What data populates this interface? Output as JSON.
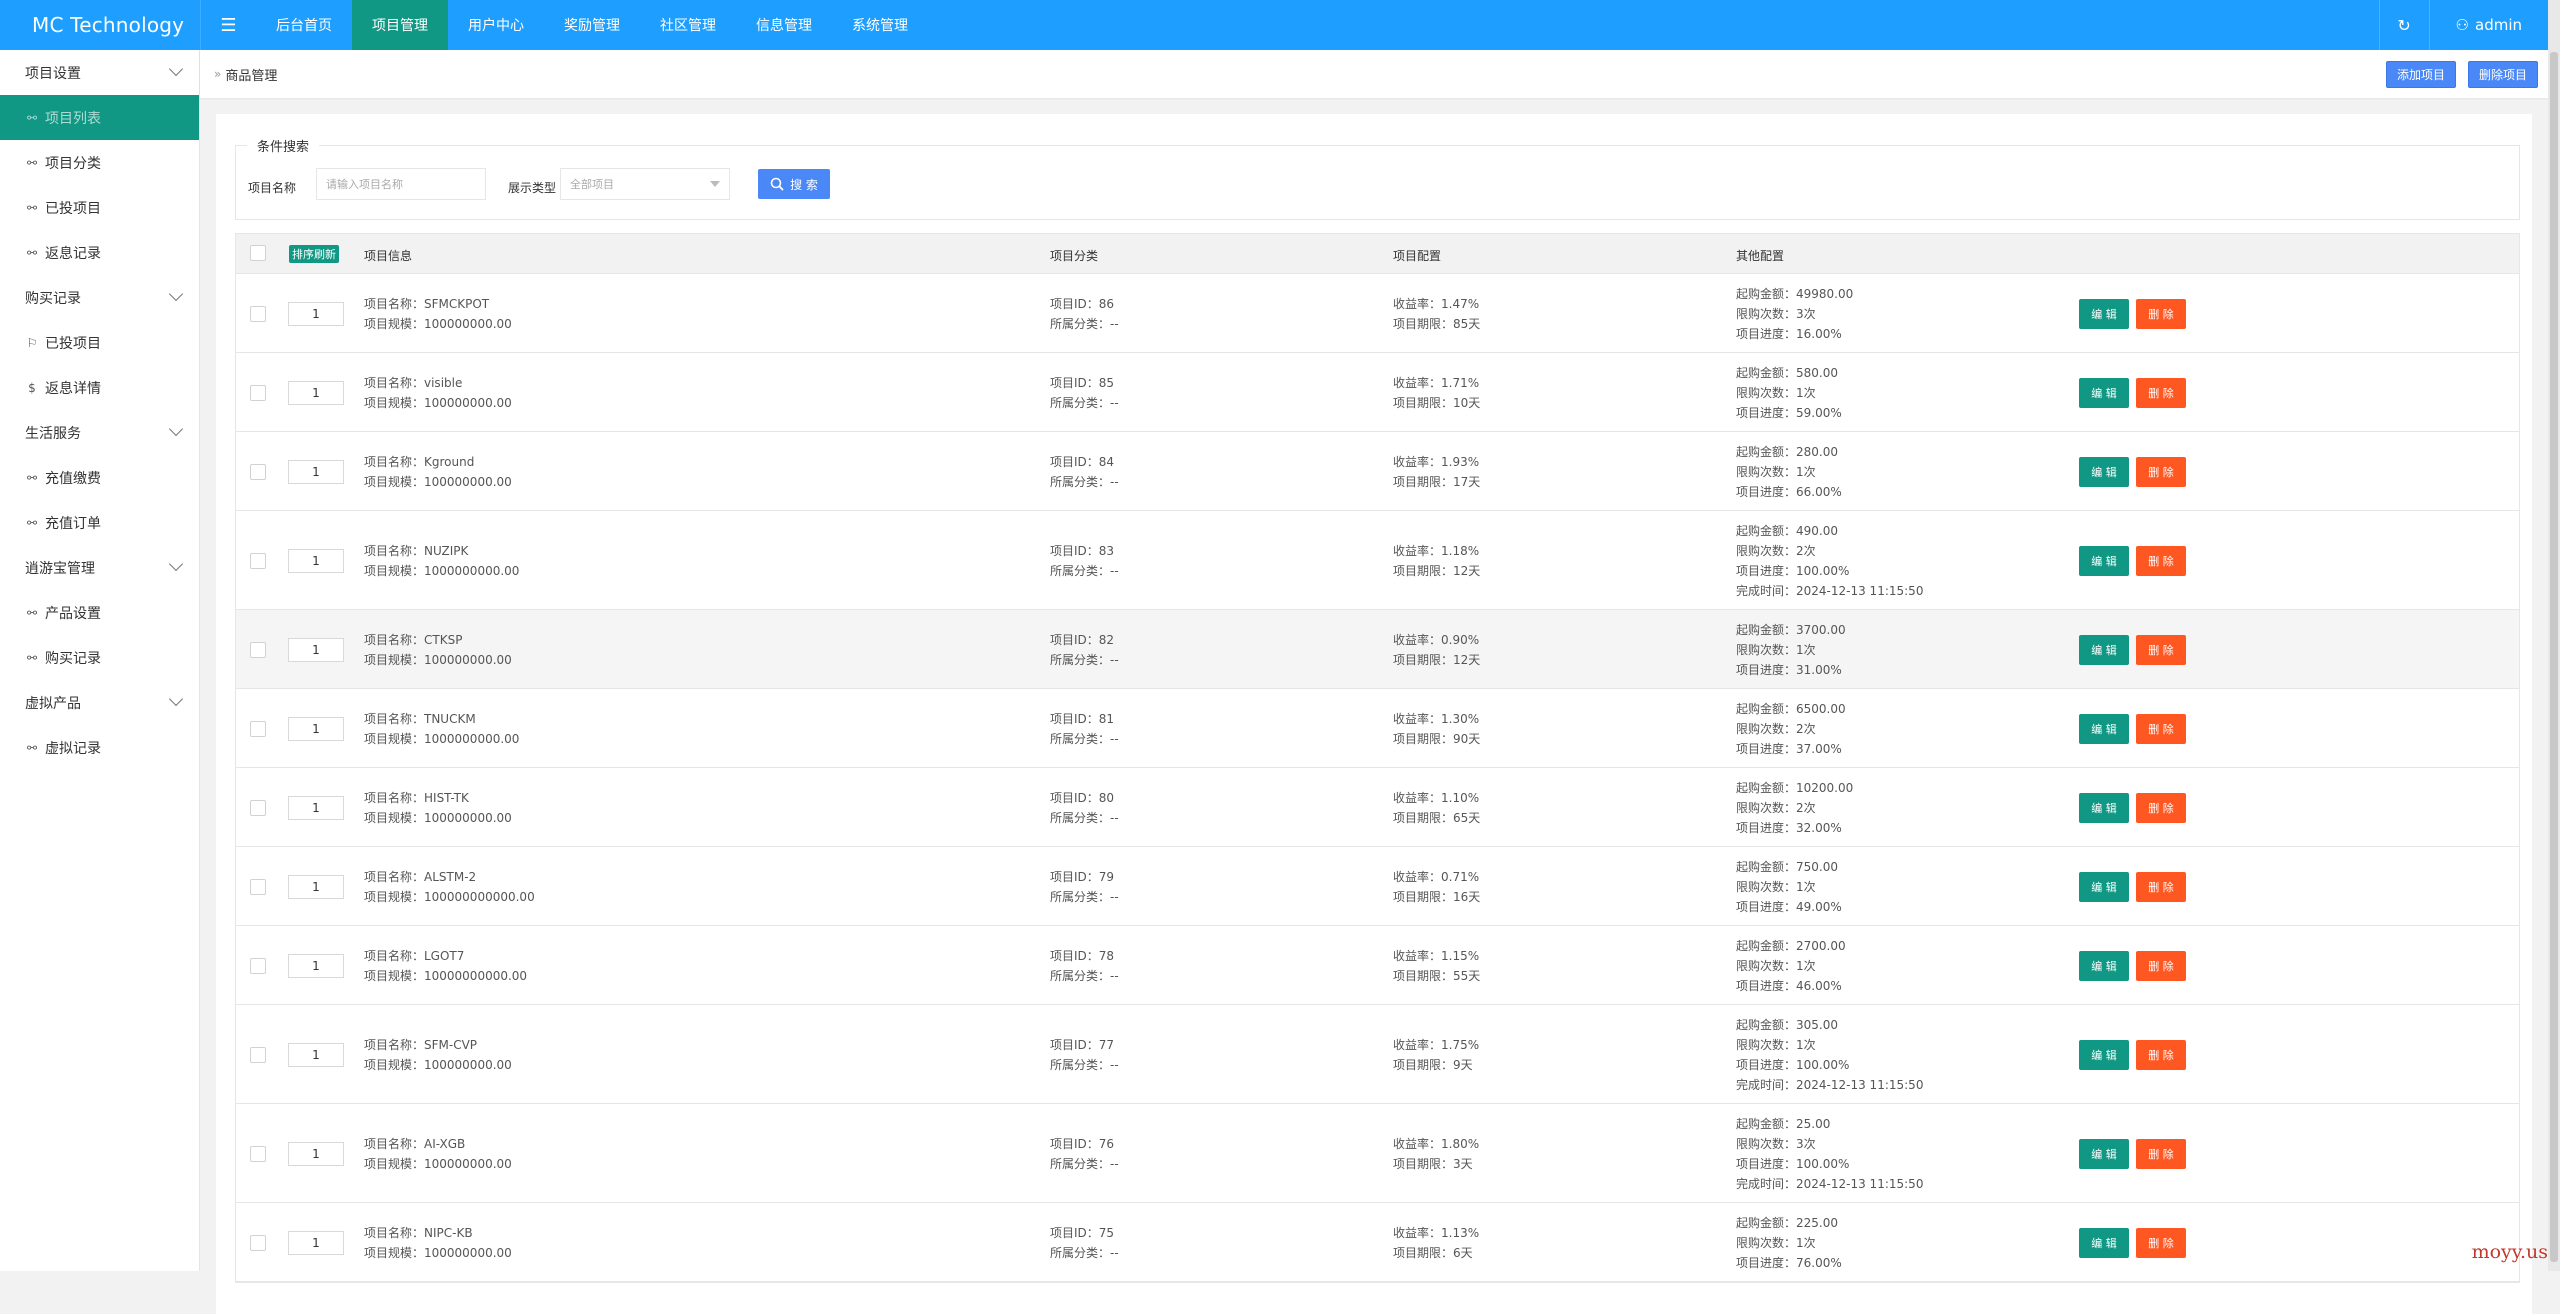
{
  "topbar": {
    "brand": "MC Technology",
    "nav": [
      "后台首页",
      "项目管理",
      "用户中心",
      "奖励管理",
      "社区管理",
      "信息管理",
      "系统管理"
    ],
    "active_nav": 1,
    "user": "admin",
    "accent": "#1e9fff",
    "active_color": "#119885"
  },
  "sidebar": [
    {
      "label": "项目设置",
      "type": "group"
    },
    {
      "label": "项目列表",
      "type": "active",
      "icon": "link-icon"
    },
    {
      "label": "项目分类",
      "type": "sub",
      "icon": "link-icon"
    },
    {
      "label": "已投项目",
      "type": "sub",
      "icon": "link-icon"
    },
    {
      "label": "返息记录",
      "type": "sub",
      "icon": "link-icon"
    },
    {
      "label": "购买记录",
      "type": "group"
    },
    {
      "label": "已投项目",
      "type": "sub",
      "icon": "flag-icon"
    },
    {
      "label": "返息详情",
      "type": "sub",
      "icon": "coin-icon"
    },
    {
      "label": "生活服务",
      "type": "group"
    },
    {
      "label": "充值缴费",
      "type": "sub",
      "icon": "link-icon"
    },
    {
      "label": "充值订单",
      "type": "sub",
      "icon": "link-icon"
    },
    {
      "label": "逍游宝管理",
      "type": "group"
    },
    {
      "label": "产品设置",
      "type": "sub",
      "icon": "link-icon"
    },
    {
      "label": "购买记录",
      "type": "sub",
      "icon": "link-icon"
    },
    {
      "label": "虚拟产品",
      "type": "group"
    },
    {
      "label": "虚拟记录",
      "type": "sub",
      "icon": "link-icon"
    }
  ],
  "breadcrumb": "商品管理",
  "actions": {
    "add": "添加项目",
    "delete": "删除项目"
  },
  "search": {
    "legend": "条件搜索",
    "name_label": "项目名称",
    "name_placeholder": "请输入项目名称",
    "type_label": "展示类型",
    "type_value": "全部项目",
    "button": "搜 索"
  },
  "table": {
    "sort_tag": "排序刷新",
    "headers": [
      "项目信息",
      "项目分类",
      "项目配置",
      "其他配置"
    ],
    "edit_label": "编 辑",
    "delete_label": "删 除",
    "rows": [
      {
        "sort": "1",
        "name": "项目名称：SFMCKPOT",
        "scale": "项目规模：100000000.00",
        "id": "项目ID：86",
        "cat": "所属分类：--",
        "rate": "收益率：1.47%",
        "period": "项目期限：85天",
        "other": [
          "起购金额：49980.00",
          "限购次数：3次",
          "项目进度：16.00%"
        ]
      },
      {
        "sort": "1",
        "name": "项目名称：visible",
        "scale": "项目规模：100000000.00",
        "id": "项目ID：85",
        "cat": "所属分类：--",
        "rate": "收益率：1.71%",
        "period": "项目期限：10天",
        "other": [
          "起购金额：580.00",
          "限购次数：1次",
          "项目进度：59.00%"
        ]
      },
      {
        "sort": "1",
        "name": "项目名称：Kground",
        "scale": "项目规模：100000000.00",
        "id": "项目ID：84",
        "cat": "所属分类：--",
        "rate": "收益率：1.93%",
        "period": "项目期限：17天",
        "other": [
          "起购金额：280.00",
          "限购次数：1次",
          "项目进度：66.00%"
        ]
      },
      {
        "sort": "1",
        "name": "项目名称：NUZIPK",
        "scale": "项目规模：1000000000.00",
        "id": "项目ID：83",
        "cat": "所属分类：--",
        "rate": "收益率：1.18%",
        "period": "项目期限：12天",
        "other": [
          "起购金额：490.00",
          "限购次数：2次",
          "项目进度：100.00%",
          "完成时间：2024-12-13 11:15:50"
        ]
      },
      {
        "sort": "1",
        "name": "项目名称：CTKSP",
        "scale": "项目规模：100000000.00",
        "id": "项目ID：82",
        "cat": "所属分类：--",
        "rate": "收益率：0.90%",
        "period": "项目期限：12天",
        "other": [
          "起购金额：3700.00",
          "限购次数：1次",
          "项目进度：31.00%"
        ]
      },
      {
        "sort": "1",
        "name": "项目名称：TNUCKM",
        "scale": "项目规模：1000000000.00",
        "id": "项目ID：81",
        "cat": "所属分类：--",
        "rate": "收益率：1.30%",
        "period": "项目期限：90天",
        "other": [
          "起购金额：6500.00",
          "限购次数：2次",
          "项目进度：37.00%"
        ]
      },
      {
        "sort": "1",
        "name": "项目名称：HIST-TK",
        "scale": "项目规模：100000000.00",
        "id": "项目ID：80",
        "cat": "所属分类：--",
        "rate": "收益率：1.10%",
        "period": "项目期限：65天",
        "other": [
          "起购金额：10200.00",
          "限购次数：2次",
          "项目进度：32.00%"
        ]
      },
      {
        "sort": "1",
        "name": "项目名称：ALSTM-2",
        "scale": "项目规模：100000000000.00",
        "id": "项目ID：79",
        "cat": "所属分类：--",
        "rate": "收益率：0.71%",
        "period": "项目期限：16天",
        "other": [
          "起购金额：750.00",
          "限购次数：1次",
          "项目进度：49.00%"
        ]
      },
      {
        "sort": "1",
        "name": "项目名称：LGOT7",
        "scale": "项目规模：10000000000.00",
        "id": "项目ID：78",
        "cat": "所属分类：--",
        "rate": "收益率：1.15%",
        "period": "项目期限：55天",
        "other": [
          "起购金额：2700.00",
          "限购次数：1次",
          "项目进度：46.00%"
        ]
      },
      {
        "sort": "1",
        "name": "项目名称：SFM-CVP",
        "scale": "项目规模：100000000.00",
        "id": "项目ID：77",
        "cat": "所属分类：--",
        "rate": "收益率：1.75%",
        "period": "项目期限：9天",
        "other": [
          "起购金额：305.00",
          "限购次数：1次",
          "项目进度：100.00%",
          "完成时间：2024-12-13 11:15:50"
        ]
      },
      {
        "sort": "1",
        "name": "项目名称：AI-XGB",
        "scale": "项目规模：100000000.00",
        "id": "项目ID：76",
        "cat": "所属分类：--",
        "rate": "收益率：1.80%",
        "period": "项目期限：3天",
        "other": [
          "起购金额：25.00",
          "限购次数：3次",
          "项目进度：100.00%",
          "完成时间：2024-12-13 11:15:50"
        ]
      },
      {
        "sort": "1",
        "name": "项目名称：NIPC-KB",
        "scale": "项目规模：100000000.00",
        "id": "项目ID：75",
        "cat": "所属分类：--",
        "rate": "收益率：1.13%",
        "period": "项目期限：6天",
        "other": [
          "起购金额：225.00",
          "限购次数：1次",
          "项目进度：76.00%"
        ]
      }
    ]
  },
  "watermark": "moyy.us"
}
